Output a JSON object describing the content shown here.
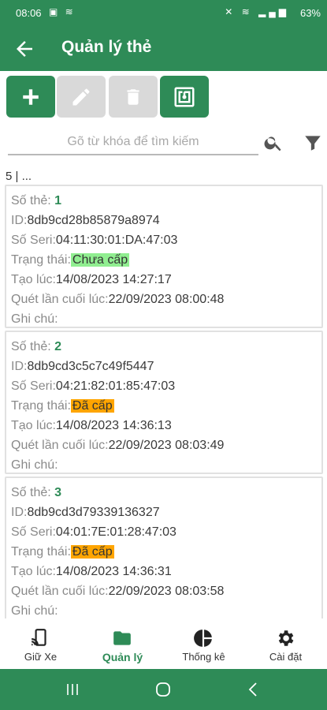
{
  "status_bar": {
    "time": "08:06",
    "battery": "63%"
  },
  "app_bar": {
    "title": "Quản lý thẻ"
  },
  "toolbar": {
    "buttons": [
      {
        "icon": "plus-icon",
        "enabled": true
      },
      {
        "icon": "pencil-icon",
        "enabled": false
      },
      {
        "icon": "trash-icon",
        "enabled": false
      },
      {
        "icon": "nfc-icon",
        "enabled": true
      }
    ]
  },
  "search": {
    "placeholder": "Gõ từ khóa để tìm kiếm",
    "value": ""
  },
  "list_count": "5 | ...",
  "labels": {
    "number": "Số thẻ:",
    "id": "ID:",
    "serial": "Số Seri:",
    "status": "Trạng thái:",
    "created": "Tạo lúc:",
    "last_scan": "Quét lần cuối lúc:",
    "note": "Ghi chú:"
  },
  "cards": [
    {
      "number": "1",
      "id": "8db9cd28b85879a8974",
      "serial": "04:11:30:01:DA:47:03",
      "status": "Chưa cấp",
      "status_color": "#90ee90",
      "created": "14/08/2023 14:27:17",
      "last_scan": "22/09/2023 08:00:48",
      "note": ""
    },
    {
      "number": "2",
      "id": "8db9cd3c5c7c49f5447",
      "serial": "04:21:82:01:85:47:03",
      "status": "Đã cấp",
      "status_color": "#ffa500",
      "created": "14/08/2023 14:36:13",
      "last_scan": "22/09/2023 08:03:49",
      "note": ""
    },
    {
      "number": "3",
      "id": "8db9cd3d79339136327",
      "serial": "04:01:7E:01:28:47:03",
      "status": "Đã cấp",
      "status_color": "#ffa500",
      "created": "14/08/2023 14:36:31",
      "last_scan": "22/09/2023 08:03:58",
      "note": ""
    }
  ],
  "bottom_nav": [
    {
      "label": "Giữ Xe",
      "icon": "phone-cast-icon",
      "active": false
    },
    {
      "label": "Quản lý",
      "icon": "folder-icon",
      "active": true
    },
    {
      "label": "Thống kê",
      "icon": "pie-chart-icon",
      "active": false
    },
    {
      "label": "Cài đặt",
      "icon": "gear-icon",
      "active": false
    }
  ],
  "colors": {
    "primary": "#2e8b57",
    "disabled": "#d9d9d9"
  }
}
